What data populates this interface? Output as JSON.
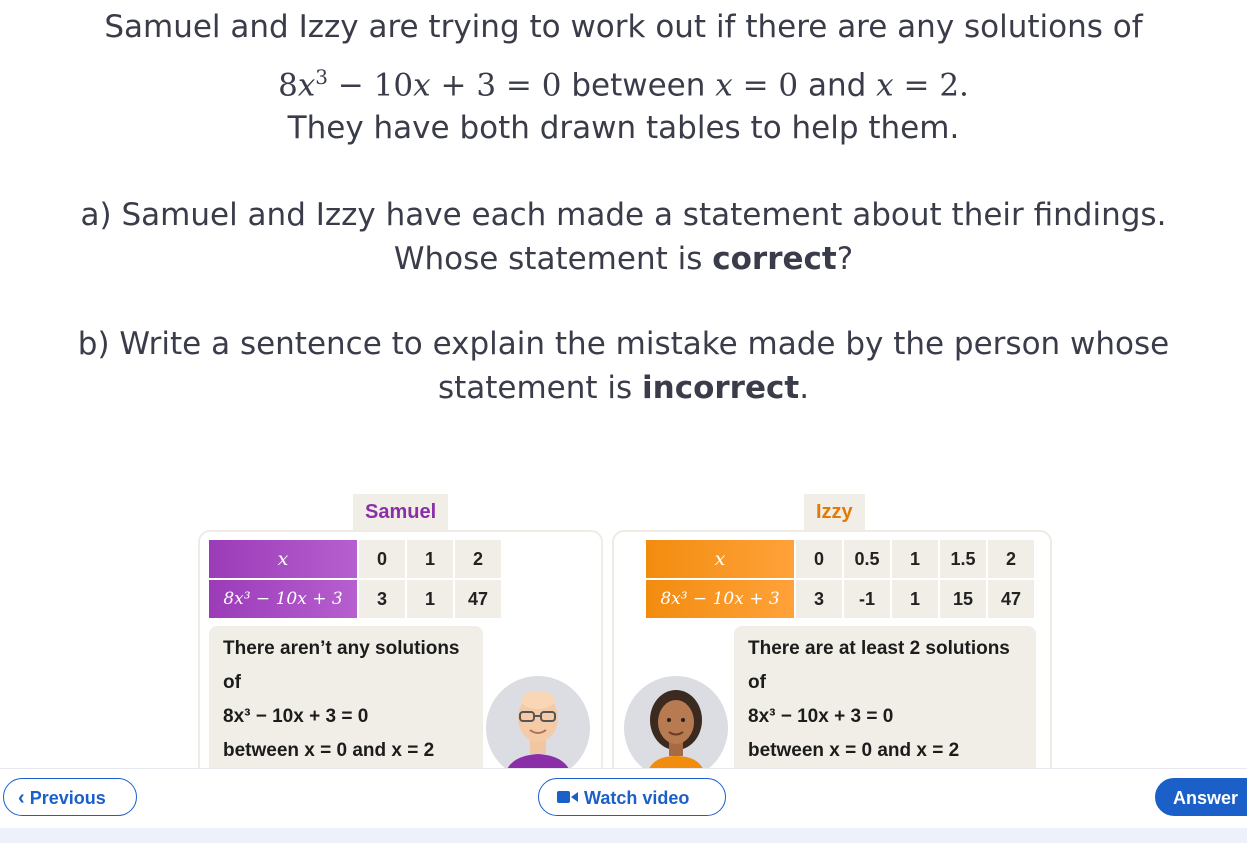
{
  "question": {
    "line1": "Samuel and Izzy are trying to work out if there are any solutions of",
    "eq_8": "8",
    "eq_x": "x",
    "eq_exp": "3",
    "eq_rest": " − 10",
    "eq_x2": "x",
    "eq_tail": " + 3 = 0",
    "between": " between ",
    "x_a": "x",
    "eq_a": " = 0",
    "and": " and ",
    "x_b": "x",
    "eq_b": " = 2.",
    "line3": "They have both drawn tables to help them.",
    "part_a_1": "a) Samuel and Izzy have each made a statement about their findings.",
    "part_a_2_pre": "Whose statement is ",
    "part_a_2_bold": "correct",
    "part_a_2_post": "?",
    "part_b_1": "b) Write a sentence to explain the mistake made by the person whose",
    "part_b_2_pre": "statement is ",
    "part_b_2_bold": "incorrect",
    "part_b_2_post": "."
  },
  "samuel": {
    "name": "Samuel",
    "name_color": "#8a2fa8",
    "row_x_label": "x",
    "row_f_label": "8x³ − 10x + 3",
    "x_values": [
      "0",
      "1",
      "2"
    ],
    "f_values": [
      "3",
      "1",
      "47"
    ],
    "statement_1": "There aren’t any solutions of",
    "statement_2": "8x³ − 10x + 3 = 0",
    "statement_3": "between x = 0 and x = 2"
  },
  "izzy": {
    "name": "Izzy",
    "name_color": "#e37a06",
    "row_x_label": "x",
    "row_f_label": "8x³ − 10x + 3",
    "x_values": [
      "0",
      "0.5",
      "1",
      "1.5",
      "2"
    ],
    "f_values": [
      "3",
      "-1",
      "1",
      "15",
      "47"
    ],
    "statement_1": "There are at least 2 solutions of",
    "statement_2": "8x³ − 10x + 3 = 0",
    "statement_3": "between x = 0 and x = 2"
  },
  "footer": {
    "previous_label": "Previous",
    "watch_label": "Watch video",
    "answer_label": "Answer"
  },
  "colors": {
    "accent": "#1b60c9",
    "samuel": "#9b3bb8",
    "izzy": "#f28c0f"
  }
}
